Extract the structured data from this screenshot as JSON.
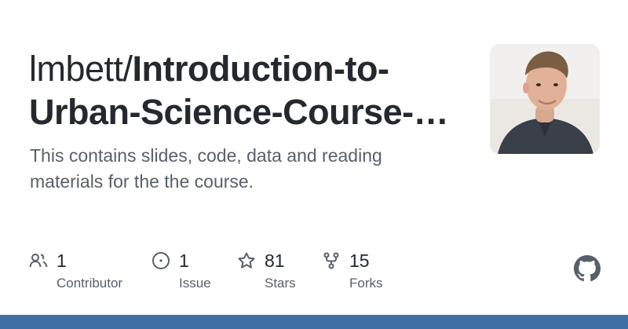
{
  "repo": {
    "owner": "lmbett/",
    "name": "Introduction-to-Urban-Science-Course-…",
    "description": "This contains slides, code, data and reading materials for the the course."
  },
  "stats": {
    "contributors": {
      "value": "1",
      "label": "Contributor",
      "icon": "people-icon"
    },
    "issues": {
      "value": "1",
      "label": "Issue",
      "icon": "issue-icon"
    },
    "stars": {
      "value": "81",
      "label": "Stars",
      "icon": "star-icon"
    },
    "forks": {
      "value": "15",
      "label": "Forks",
      "icon": "fork-icon"
    }
  },
  "colors": {
    "text": "#24292f",
    "muted": "#57606a",
    "bar": "#3f6fa3"
  }
}
